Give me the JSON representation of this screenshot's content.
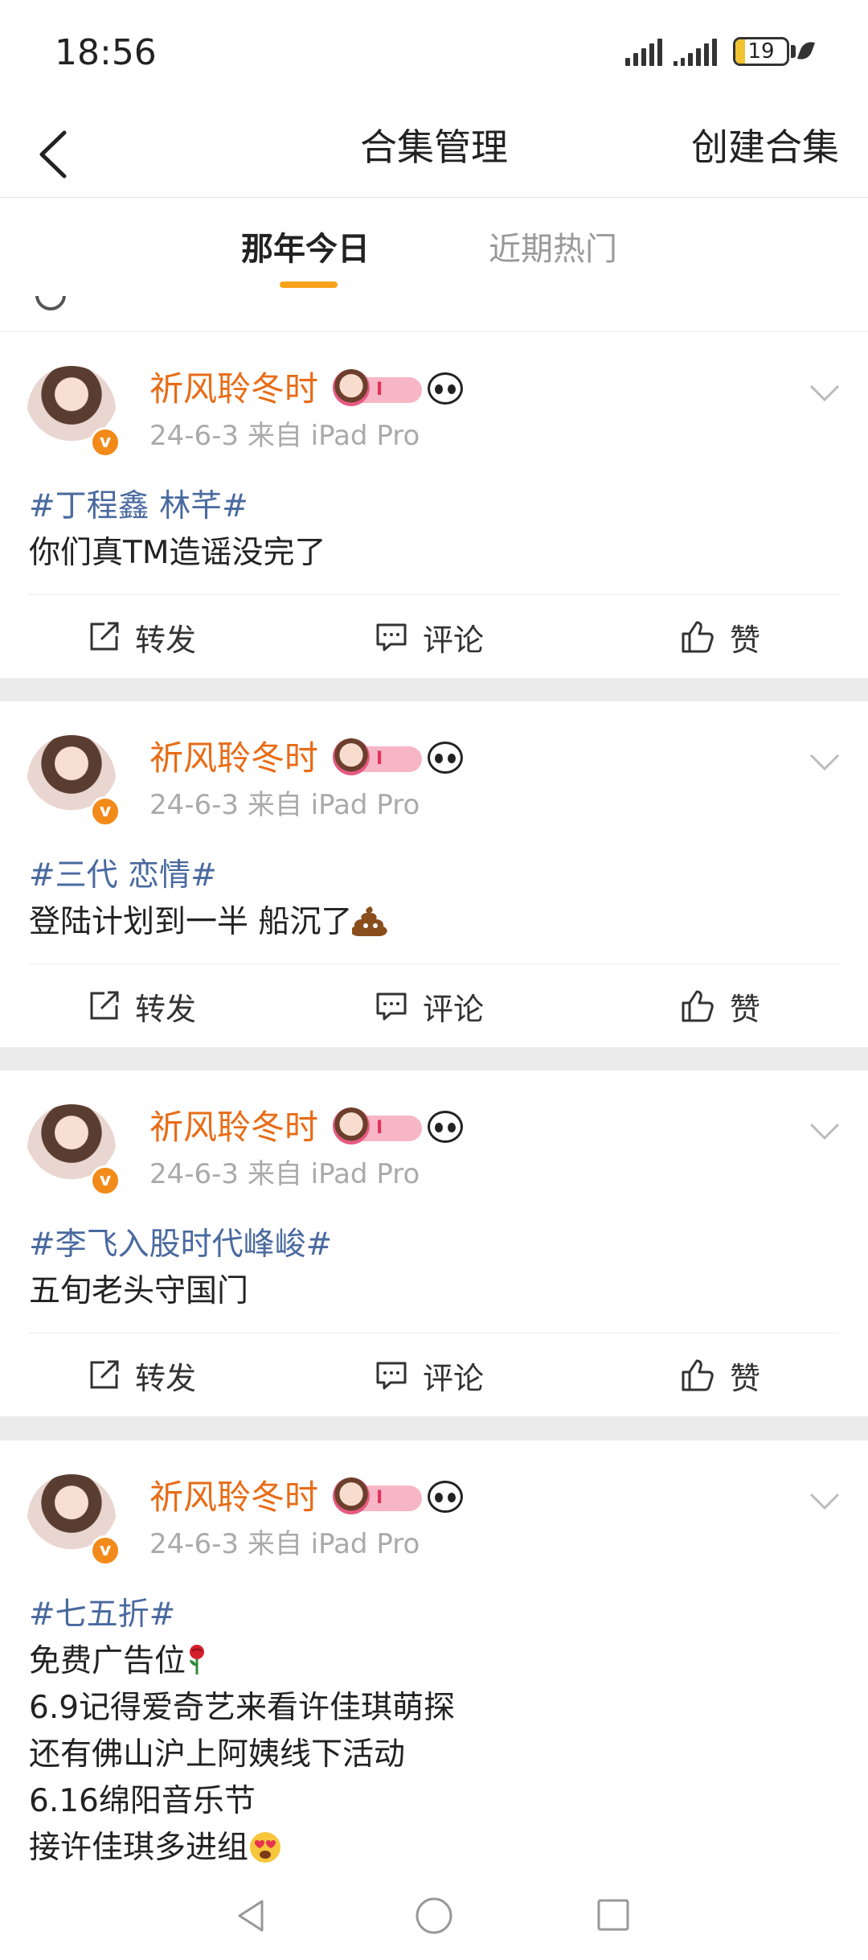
{
  "status_bar": {
    "time": "18:56",
    "battery": "19",
    "battery_level": 0.19
  },
  "nav": {
    "title": "合集管理",
    "action": "创建合集"
  },
  "tabs": [
    {
      "label": "那年今日",
      "active": true
    },
    {
      "label": "近期热门",
      "active": false
    }
  ],
  "posts": [
    {
      "author": "祈风聆冬时",
      "badge": "I",
      "meta": "24-6-3  来自 iPad Pro",
      "hashtag": "#丁程鑫 林芊#",
      "lines": [
        "你们真TM造谣没完了"
      ],
      "actions": {
        "repost": "转发",
        "comment": "评论",
        "like": "赞"
      }
    },
    {
      "author": "祈风聆冬时",
      "badge": "I",
      "meta": "24-6-3  来自 iPad Pro",
      "hashtag": "#三代 恋情#",
      "lines": [
        "登陆计划到一半 船沉了"
      ],
      "emoji": "poop-icon",
      "actions": {
        "repost": "转发",
        "comment": "评论",
        "like": "赞"
      }
    },
    {
      "author": "祈风聆冬时",
      "badge": "I",
      "meta": "24-6-3  来自 iPad Pro",
      "hashtag": "#李飞入股时代峰峻#",
      "lines": [
        "五旬老头守国门"
      ],
      "actions": {
        "repost": "转发",
        "comment": "评论",
        "like": "赞"
      }
    },
    {
      "author": "祈风聆冬时",
      "badge": "I",
      "meta": "24-6-3  来自 iPad Pro",
      "hashtag": "#七五折#",
      "lines": [
        "免费广告位",
        "6.9记得爱奇艺来看许佳琪萌探",
        "还有佛山沪上阿姨线下活动",
        "6.16绵阳音乐节",
        "接许佳琪多进组"
      ],
      "emoji": "rose-icon, heart-eyes-icon"
    }
  ]
}
